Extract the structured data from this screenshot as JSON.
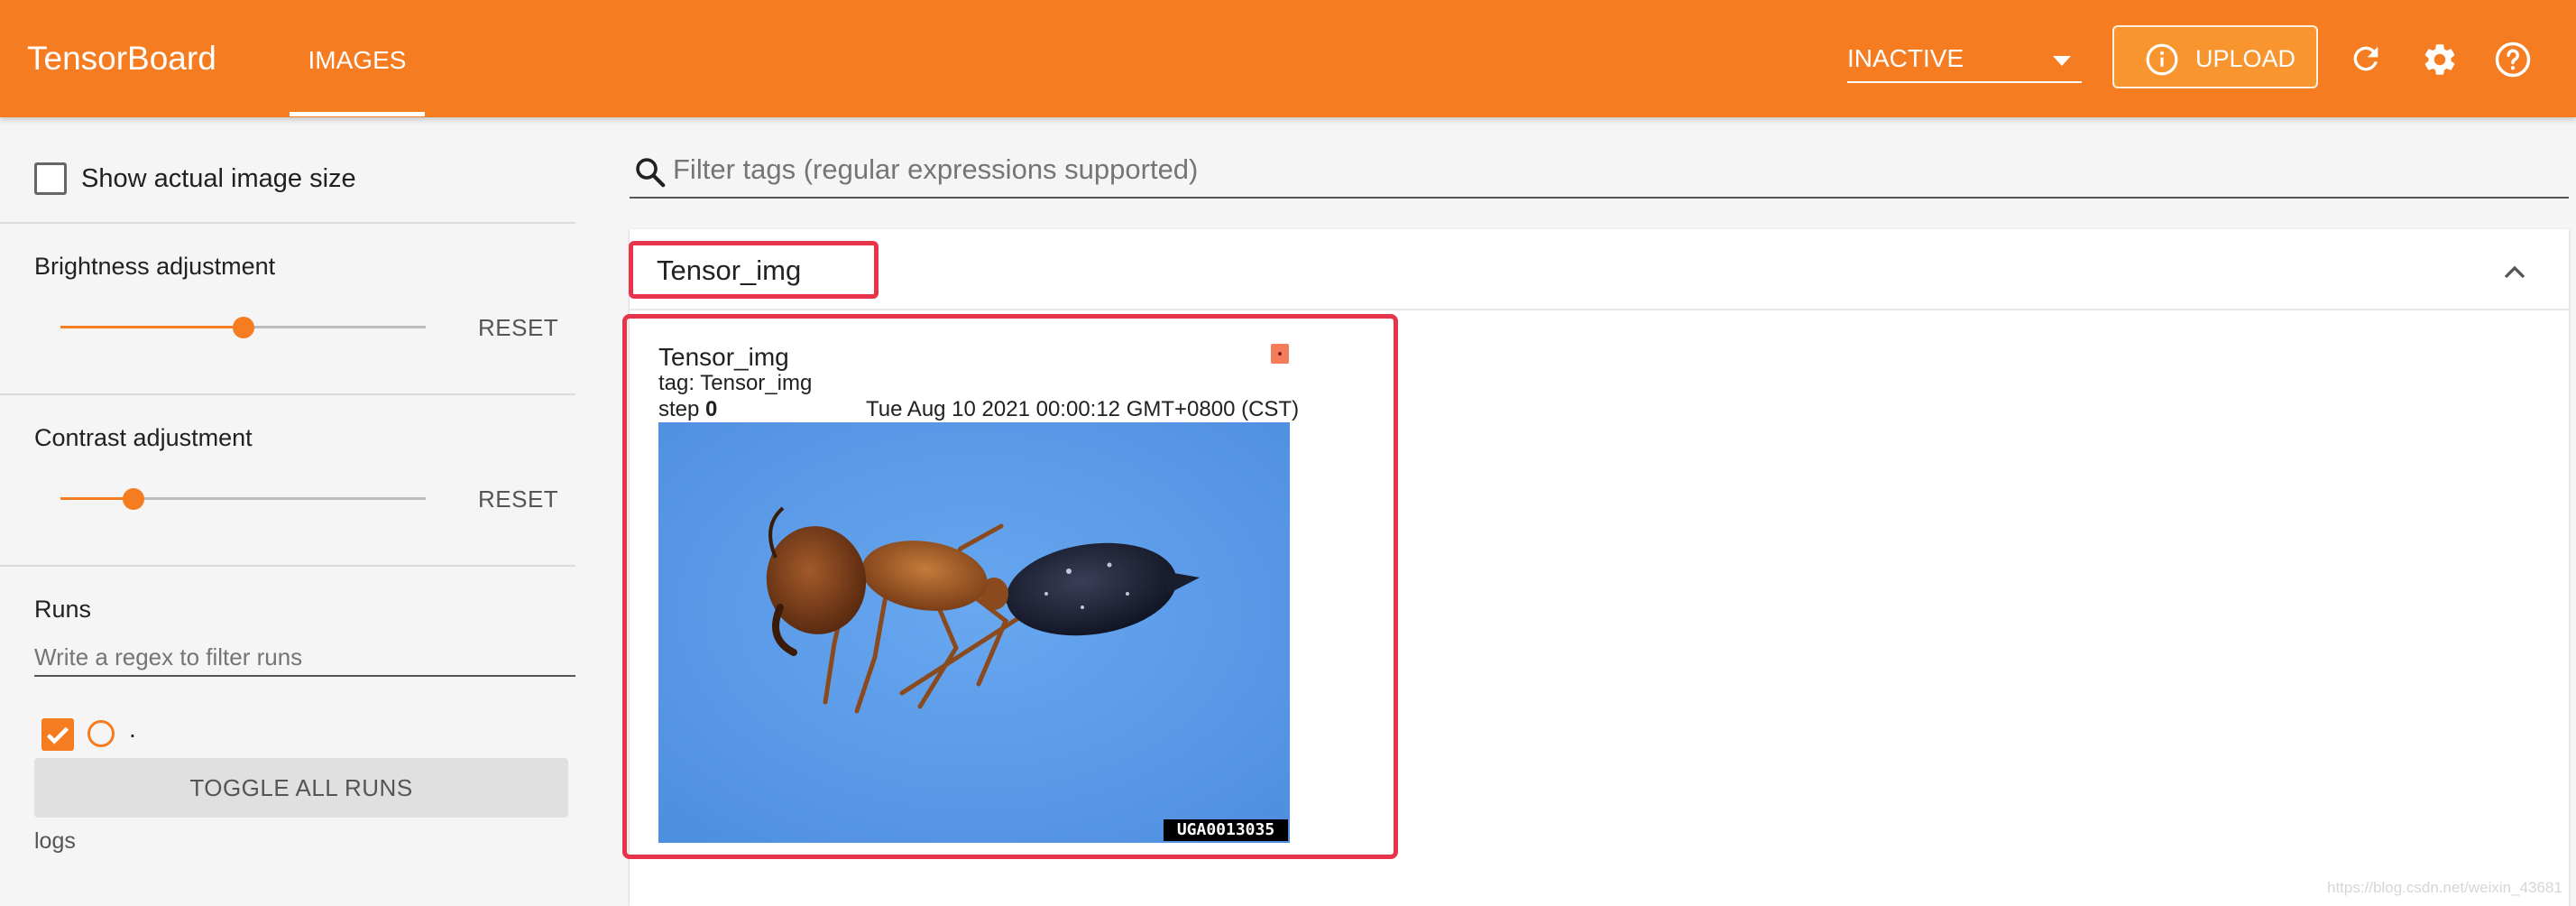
{
  "header": {
    "brand": "TensorBoard",
    "active_tab": "IMAGES",
    "status_select": "INACTIVE",
    "upload_label": "UPLOAD",
    "accent_color": "#f57c20"
  },
  "sidebar": {
    "show_actual_size_label": "Show actual image size",
    "show_actual_size_checked": false,
    "brightness": {
      "title": "Brightness adjustment",
      "reset_label": "RESET",
      "level": 0.5
    },
    "contrast": {
      "title": "Contrast adjustment",
      "reset_label": "RESET",
      "level": 0.2
    },
    "runs": {
      "title": "Runs",
      "filter_placeholder": "Write a regex to filter runs",
      "items": [
        {
          "name": ".",
          "checked": true,
          "color": "#f57c20"
        }
      ],
      "toggle_all_label": "TOGGLE ALL RUNS",
      "logdir": "logs"
    }
  },
  "main": {
    "search_placeholder": "Filter tags (regular expressions supported)",
    "section": {
      "title": "Tensor_img",
      "card": {
        "name": "Tensor_img",
        "tag_line": "tag: Tensor_img",
        "step_label": "step",
        "step_value": "0",
        "timestamp": "Tue Aug 10 2021 00:00:12 GMT+0800 (CST)",
        "image_caption": "UGA0013035"
      }
    }
  },
  "watermark": "https://blog.csdn.net/weixin_43681"
}
